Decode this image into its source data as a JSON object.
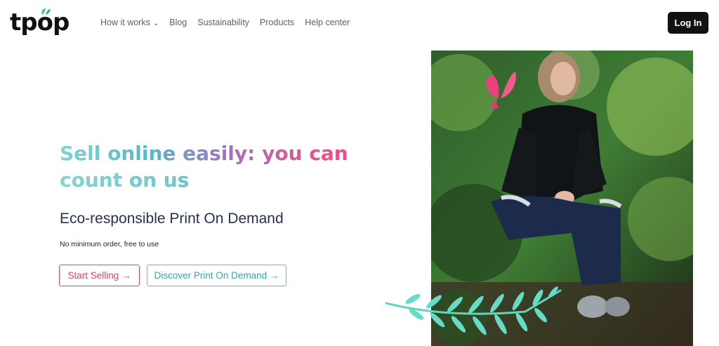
{
  "header": {
    "logo_text": "tpop",
    "nav": [
      {
        "label": "How it works",
        "has_dropdown": true
      },
      {
        "label": "Blog"
      },
      {
        "label": "Sustainability"
      },
      {
        "label": "Products"
      },
      {
        "label": "Help center"
      }
    ],
    "login_label": "Log In"
  },
  "hero": {
    "headline_line1": "Sell online easily: you can",
    "headline_line2": "count on us",
    "subheadline": "Eco-responsible Print On Demand",
    "note": "No minimum order, free to use",
    "primary_button": "Start Selling →",
    "secondary_button": "Discover Print On Demand →"
  },
  "colors": {
    "accent_pink": "#d8476f",
    "accent_teal": "#59c3bb",
    "text_dark": "#24324a"
  }
}
